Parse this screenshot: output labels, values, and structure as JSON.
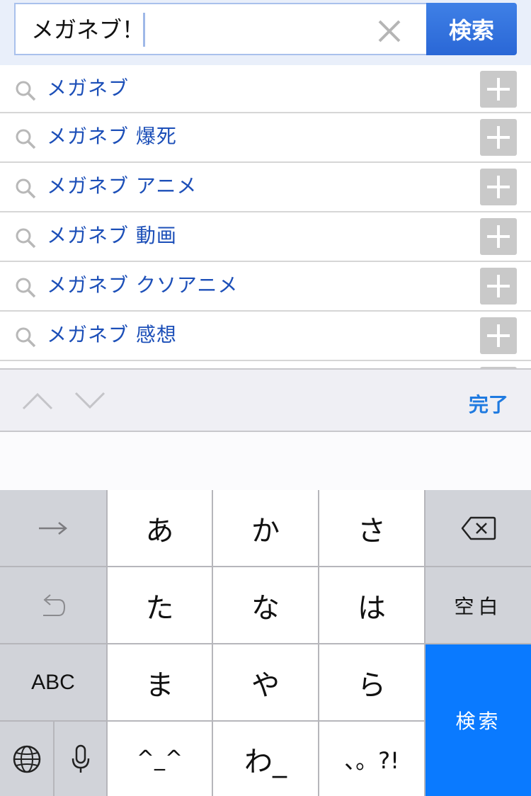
{
  "search": {
    "query": "メガネブ！",
    "button_label": "検索"
  },
  "suggestions": [
    {
      "label": "メガネブ"
    },
    {
      "label": "メガネブ 爆死"
    },
    {
      "label": "メガネブ アニメ"
    },
    {
      "label": "メガネブ 動画"
    },
    {
      "label": "メガネブ クソアニメ"
    },
    {
      "label": "メガネブ 感想"
    }
  ],
  "accessory": {
    "done_label": "完了"
  },
  "keyboard": {
    "keys": {
      "a": "あ",
      "ka": "か",
      "sa": "さ",
      "ta": "た",
      "na": "な",
      "ha": "は",
      "ma": "ま",
      "ya": "や",
      "ra": "ら",
      "emoticon": "^_^",
      "wa": "わ_",
      "punct": "、。?!",
      "space": "空白",
      "abc": "ABC",
      "search": "検索"
    }
  },
  "colors": {
    "accent_blue": "#0a7aff",
    "suggestion_text": "#1c4fb8",
    "search_button": "#3672de"
  },
  "icons": [
    "clear-icon",
    "search-icon",
    "plus-icon",
    "chevron-up-icon",
    "chevron-down-icon",
    "arrow-right-icon",
    "backspace-icon",
    "undo-icon",
    "globe-icon",
    "microphone-icon"
  ]
}
